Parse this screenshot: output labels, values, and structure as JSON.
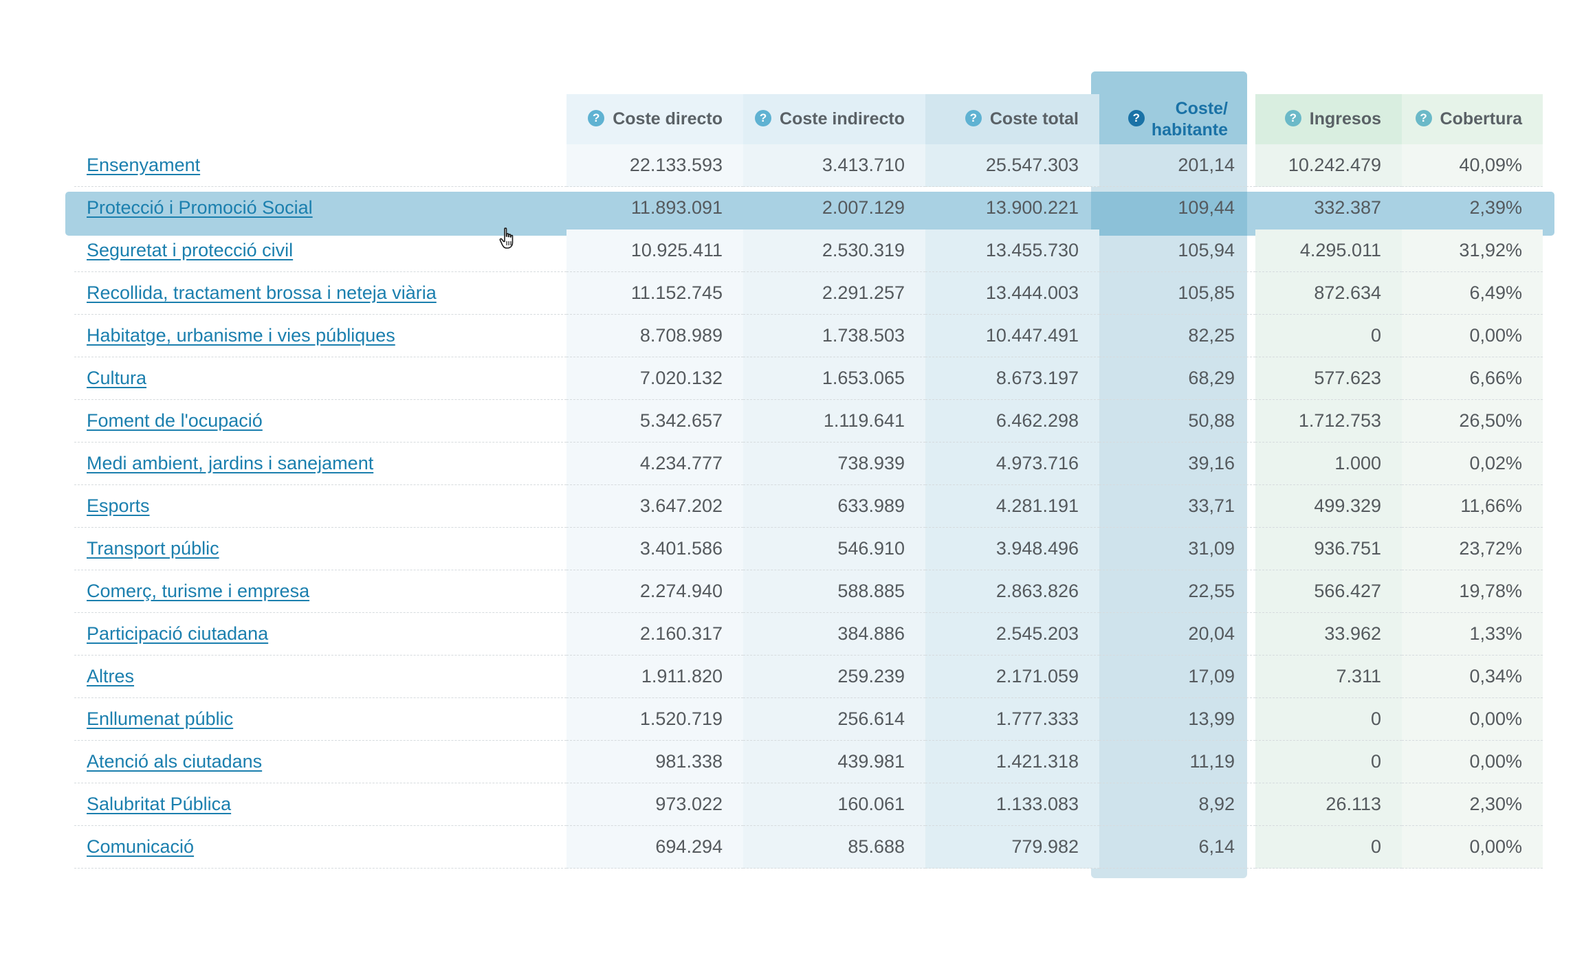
{
  "table": {
    "headers": {
      "label": "",
      "coste_directo": "Coste directo",
      "coste_indirecto": "Coste indirecto",
      "coste_total": "Coste total",
      "coste_habitante_line1": "Coste/",
      "coste_habitante_line2": "habitante",
      "ingresos": "Ingresos",
      "cobertura": "Cobertura"
    },
    "help_glyph": "?",
    "hovered_row_index": 1,
    "rows": [
      {
        "label": "Ensenyament",
        "coste_directo": "22.133.593",
        "coste_indirecto": "3.413.710",
        "coste_total": "25.547.303",
        "coste_habitante": "201,14",
        "ingresos": "10.242.479",
        "cobertura": "40,09%"
      },
      {
        "label": "Protecció i Promoció Social",
        "coste_directo": "11.893.091",
        "coste_indirecto": "2.007.129",
        "coste_total": "13.900.221",
        "coste_habitante": "109,44",
        "ingresos": "332.387",
        "cobertura": "2,39%"
      },
      {
        "label": "Seguretat i protecció civil",
        "coste_directo": "10.925.411",
        "coste_indirecto": "2.530.319",
        "coste_total": "13.455.730",
        "coste_habitante": "105,94",
        "ingresos": "4.295.011",
        "cobertura": "31,92%"
      },
      {
        "label": "Recollida, tractament brossa i neteja viària",
        "coste_directo": "11.152.745",
        "coste_indirecto": "2.291.257",
        "coste_total": "13.444.003",
        "coste_habitante": "105,85",
        "ingresos": "872.634",
        "cobertura": "6,49%"
      },
      {
        "label": "Habitatge, urbanisme i vies públiques",
        "coste_directo": "8.708.989",
        "coste_indirecto": "1.738.503",
        "coste_total": "10.447.491",
        "coste_habitante": "82,25",
        "ingresos": "0",
        "cobertura": "0,00%"
      },
      {
        "label": "Cultura",
        "coste_directo": "7.020.132",
        "coste_indirecto": "1.653.065",
        "coste_total": "8.673.197",
        "coste_habitante": "68,29",
        "ingresos": "577.623",
        "cobertura": "6,66%"
      },
      {
        "label": "Foment de l'ocupació",
        "coste_directo": "5.342.657",
        "coste_indirecto": "1.119.641",
        "coste_total": "6.462.298",
        "coste_habitante": "50,88",
        "ingresos": "1.712.753",
        "cobertura": "26,50%"
      },
      {
        "label": "Medi ambient, jardins i sanejament",
        "coste_directo": "4.234.777",
        "coste_indirecto": "738.939",
        "coste_total": "4.973.716",
        "coste_habitante": "39,16",
        "ingresos": "1.000",
        "cobertura": "0,02%"
      },
      {
        "label": "Esports",
        "coste_directo": "3.647.202",
        "coste_indirecto": "633.989",
        "coste_total": "4.281.191",
        "coste_habitante": "33,71",
        "ingresos": "499.329",
        "cobertura": "11,66%"
      },
      {
        "label": "Transport públic",
        "coste_directo": "3.401.586",
        "coste_indirecto": "546.910",
        "coste_total": "3.948.496",
        "coste_habitante": "31,09",
        "ingresos": "936.751",
        "cobertura": "23,72%"
      },
      {
        "label": "Comerç, turisme i empresa",
        "coste_directo": "2.274.940",
        "coste_indirecto": "588.885",
        "coste_total": "2.863.826",
        "coste_habitante": "22,55",
        "ingresos": "566.427",
        "cobertura": "19,78%"
      },
      {
        "label": "Participació ciutadana",
        "coste_directo": "2.160.317",
        "coste_indirecto": "384.886",
        "coste_total": "2.545.203",
        "coste_habitante": "20,04",
        "ingresos": "33.962",
        "cobertura": "1,33%"
      },
      {
        "label": "Altres",
        "coste_directo": "1.911.820",
        "coste_indirecto": "259.239",
        "coste_total": "2.171.059",
        "coste_habitante": "17,09",
        "ingresos": "7.311",
        "cobertura": "0,34%"
      },
      {
        "label": "Enllumenat públic",
        "coste_directo": "1.520.719",
        "coste_indirecto": "256.614",
        "coste_total": "1.777.333",
        "coste_habitante": "13,99",
        "ingresos": "0",
        "cobertura": "0,00%"
      },
      {
        "label": "Atenció als ciutadans",
        "coste_directo": "981.338",
        "coste_indirecto": "439.981",
        "coste_total": "1.421.318",
        "coste_habitante": "11,19",
        "ingresos": "0",
        "cobertura": "0,00%"
      },
      {
        "label": "Salubritat Pública",
        "coste_directo": "973.022",
        "coste_indirecto": "160.061",
        "coste_total": "1.133.083",
        "coste_habitante": "8,92",
        "ingresos": "26.113",
        "cobertura": "2,30%"
      },
      {
        "label": "Comunicació",
        "coste_directo": "694.294",
        "coste_indirecto": "85.688",
        "coste_total": "779.982",
        "coste_habitante": "6,14",
        "ingresos": "0",
        "cobertura": "0,00%"
      }
    ]
  },
  "colors": {
    "link": "#1b7fae",
    "selected_column_header": "#9dcbde",
    "selected_column_text": "#1a72a6",
    "hover_row": "#a9d1e3",
    "help_icon": "#5fb2d2"
  },
  "cursor_icon": "hand-pointer-icon"
}
